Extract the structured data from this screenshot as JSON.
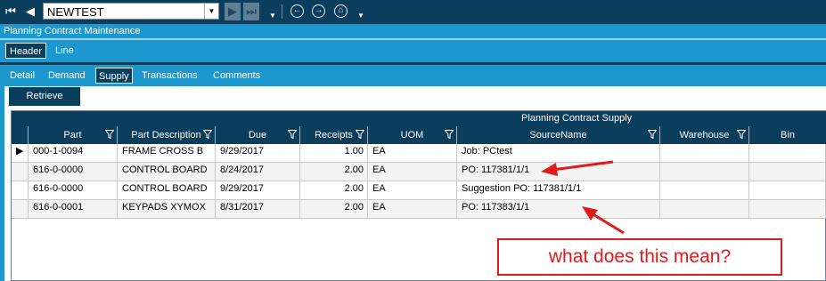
{
  "toolbar": {
    "record_value": "NEWTEST"
  },
  "title": "Planning Contract Maintenance",
  "outer_tabs": [
    {
      "label": "Header",
      "active": true
    },
    {
      "label": "Line",
      "active": false
    }
  ],
  "inner_tabs": [
    {
      "label": "Detail",
      "active": false
    },
    {
      "label": "Demand",
      "active": false
    },
    {
      "label": "Supply",
      "active": true
    },
    {
      "label": "Transactions",
      "active": false
    },
    {
      "label": "Comments",
      "active": false
    }
  ],
  "retrieve_label": "Retrieve",
  "grid": {
    "title": "Planning Contract Supply",
    "columns": [
      "Part",
      "Part Description",
      "Due",
      "Receipts",
      "UOM",
      "SourceName",
      "Warehouse",
      "Bin"
    ],
    "rows": [
      {
        "part": "000-1-0094",
        "description": "FRAME CROSS B",
        "due": "9/29/2017",
        "receipts": "1.00",
        "uom": "EA",
        "source": "Job: PCtest",
        "warehouse": "",
        "bin": ""
      },
      {
        "part": "616-0-0000",
        "description": "CONTROL BOARD",
        "due": "8/24/2017",
        "receipts": "2.00",
        "uom": "EA",
        "source": "PO: 117381/1/1",
        "warehouse": "",
        "bin": ""
      },
      {
        "part": "616-0-0000",
        "description": "CONTROL BOARD",
        "due": "9/29/2017",
        "receipts": "2.00",
        "uom": "EA",
        "source": "Suggestion PO: 117381/1/1",
        "warehouse": "",
        "bin": ""
      },
      {
        "part": "616-0-0001",
        "description": "KEYPADS  XYMOX",
        "due": "8/31/2017",
        "receipts": "2.00",
        "uom": "EA",
        "source": "PO: 117383/1/1",
        "warehouse": "",
        "bin": ""
      }
    ]
  },
  "annotation": {
    "text": "what does this mean?",
    "color": "#e01b1b"
  },
  "colors": {
    "toolbar": "#0b3d5c",
    "accent": "#1c98cf"
  }
}
